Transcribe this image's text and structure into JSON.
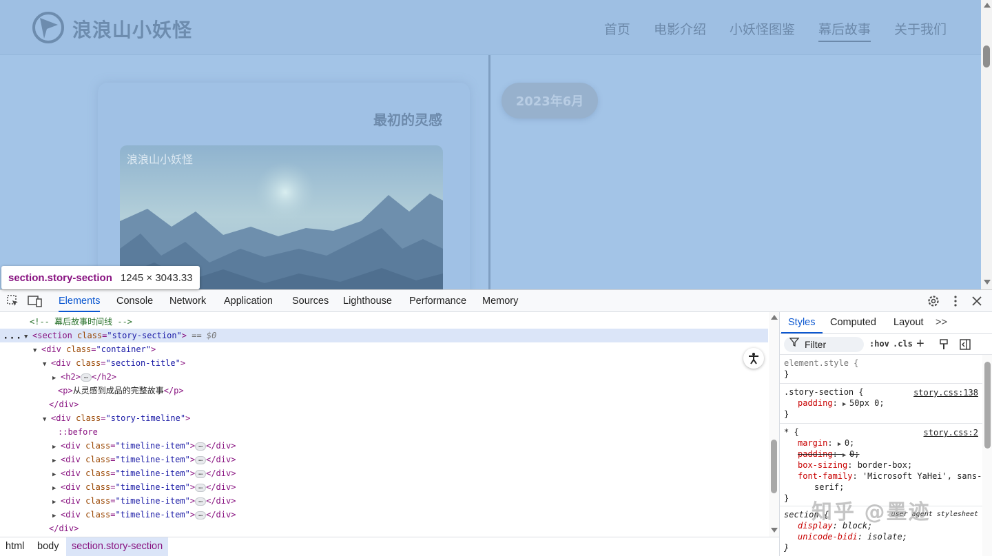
{
  "site": {
    "name": "浪浪山小妖怪",
    "nav": [
      "首页",
      "电影介绍",
      "小妖怪图鉴",
      "幕后故事",
      "关于我们"
    ],
    "active_nav": "幕后故事",
    "card_title": "最初的灵感",
    "image_caption": "浪浪山小妖怪",
    "date_badge": "2023年6月"
  },
  "inspector_tooltip": {
    "selector": "section.story-section",
    "size": "1245 × 3043.33"
  },
  "devtools": {
    "tabs": [
      "Elements",
      "Console",
      "Network",
      "Application",
      "Sources",
      "Lighthouse",
      "Performance",
      "Memory"
    ],
    "active_tab": "Elements",
    "dom": {
      "comment": "<!-- 幕后故事时间线 -->",
      "section_open_tag": "section",
      "section_attr": "class",
      "section_value": "\"story-section\"",
      "selected_marker": "== $0",
      "container_tag": "div",
      "container_value": "\"container\"",
      "section_title_value": "\"section-title\"",
      "h2": "h2",
      "p_text": "从灵感到成品的完整故事",
      "timeline_value": "\"story-timeline\"",
      "pseudo": "::before",
      "timeline_item_value": "\"timeline-item\"",
      "close_div": "</div>"
    },
    "breadcrumb": [
      "html",
      "body",
      "section.story-section"
    ],
    "styles": {
      "tabs": [
        "Styles",
        "Computed",
        "Layout"
      ],
      "active_tab": "Styles",
      "more_tabs_label": ">>",
      "filter_placeholder": "Filter",
      "hov": ":hov",
      "cls": ".cls",
      "rules": {
        "element_style": "element.style {",
        "close": "}",
        "story_selector": ".story-section {",
        "story_source": "story.css:138",
        "padding_prop": "padding",
        "padding_val": "50px 0;",
        "star_selector": "* {",
        "star_source": "story.css:2",
        "margin_prop": "margin",
        "margin_val": "0;",
        "padding_over_prop": "padding",
        "padding_over_val": "0;",
        "box_sizing_prop": "box-sizing",
        "box_sizing_val": "border-box;",
        "font_family_prop": "font-family",
        "font_family_val": "'Microsoft YaHei', sans-",
        "font_family_val2": "serif;",
        "ua_selector": "section {",
        "ua_source": "user agent stylesheet",
        "display_prop": "display",
        "display_val": "block;",
        "unicode_prop": "unicode-bidi",
        "unicode_val": "isolate;"
      }
    }
  },
  "watermark": "知乎 @墨迹"
}
